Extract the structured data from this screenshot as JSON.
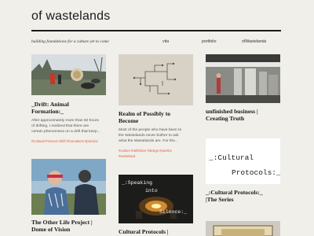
{
  "site": {
    "title": "of wastelands",
    "tagline": "building foundations for a culture yet to come"
  },
  "nav": [
    "vita",
    "portfolio",
    "ofWastelands"
  ],
  "posts": [
    {
      "title_lines": [
        "_Drift: Animal",
        "Formation:_"
      ],
      "excerpt_lines": [
        "After approximately more than 50 hours",
        "of drifting, I realized that there are",
        "certain phenomena on a drift that keep..."
      ],
      "tag_lines": [
        "#Cultural Protocol  #drift  #formations  #practice"
      ]
    },
    {
      "title_lines": [
        "Realm of Possibly to",
        "Become"
      ],
      "excerpt_lines": [
        "Most of the people who have been to",
        "the Wastelands never bother to ask",
        "what the Wastelands are. For the..."
      ],
      "tag_lines": [
        "#culture  #definition  #design  #poetics",
        "#wasteland"
      ]
    },
    {
      "title_lines": [
        "unfinished business |",
        "Creating Truth"
      ],
      "excerpt_lines": [],
      "tag_lines": []
    },
    {
      "title_lines": [
        "_:Cultural Protocols:_",
        "|The Series"
      ],
      "thumb_text": [
        "_:Cultural",
        "Protocols:_"
      ],
      "excerpt_lines": [],
      "tag_lines": []
    },
    {
      "title_lines": [
        "The Other Life Project |",
        "Dome of Vision"
      ],
      "excerpt_lines": [],
      "tag_lines": []
    },
    {
      "title_lines": [
        "Cultural Protocols |"
      ],
      "thumb_text": [
        "_:Speaking",
        "into",
        "Silence:_"
      ],
      "excerpt_lines": [],
      "tag_lines": []
    }
  ],
  "colors": {
    "background": "#f0efea",
    "tag": "#e2603b",
    "rule": "#1a1a1a"
  }
}
